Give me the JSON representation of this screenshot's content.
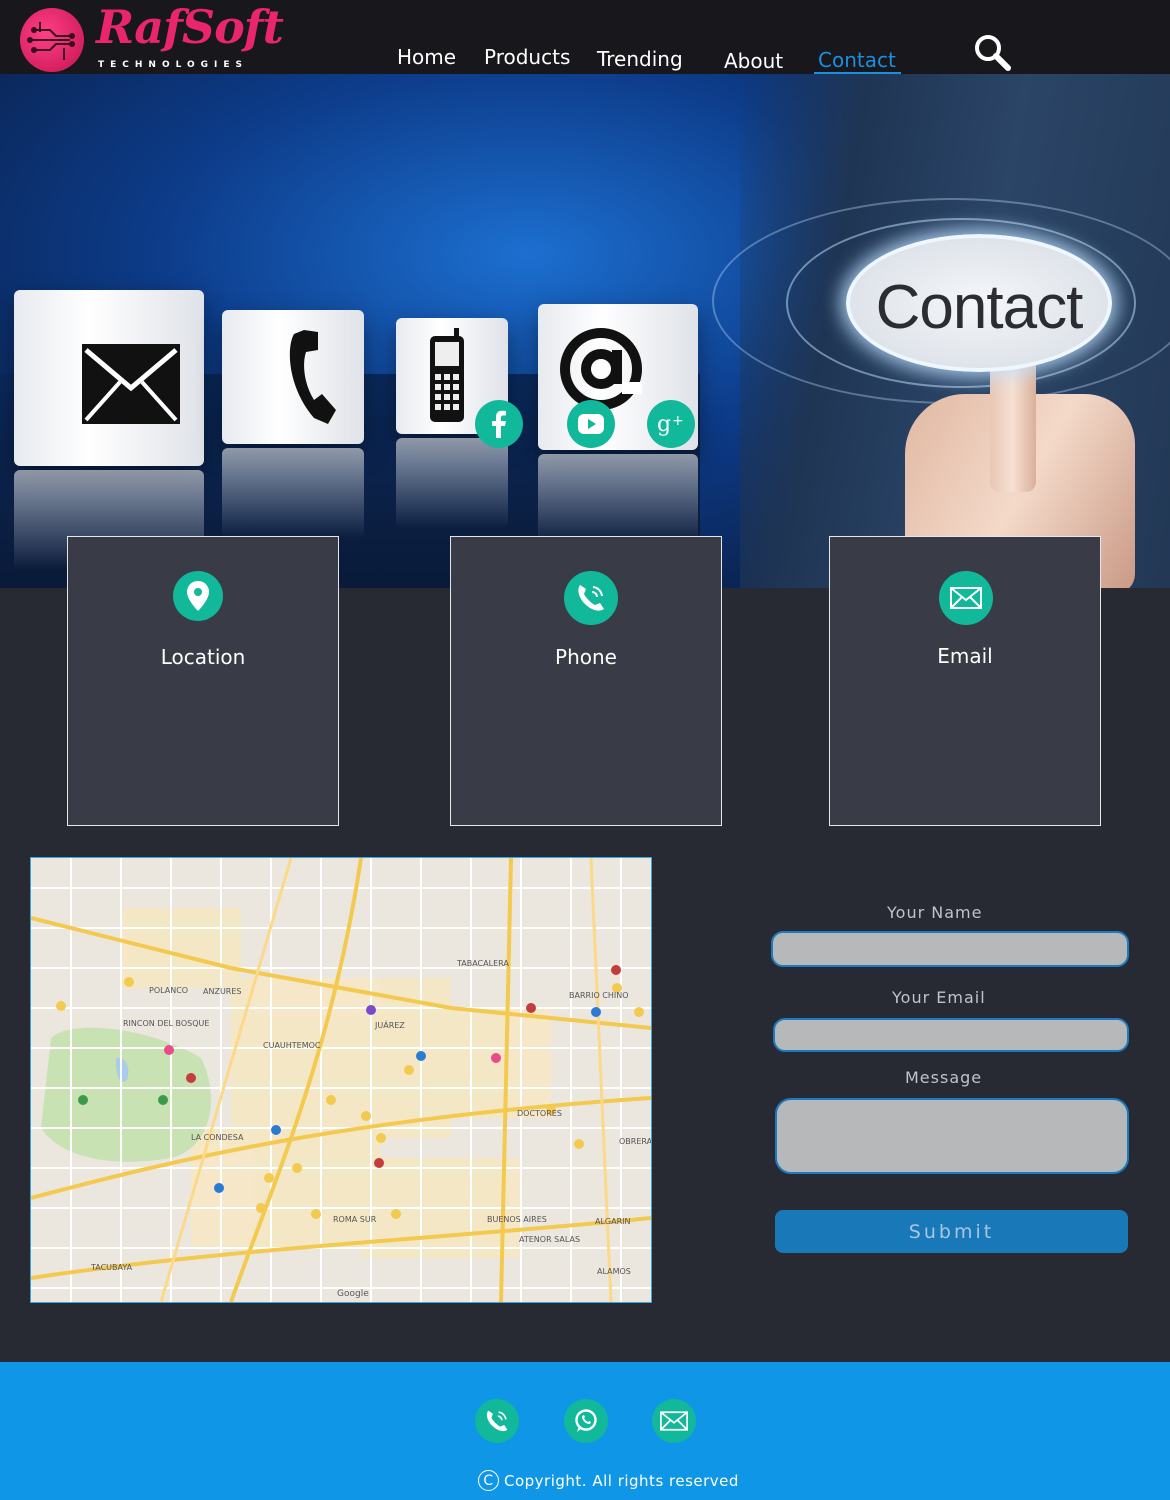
{
  "brand": {
    "name": "RafSoft",
    "tagline": "TECHNOLOGIES",
    "accent": "#e8256d"
  },
  "nav": {
    "items": [
      {
        "label": "Home"
      },
      {
        "label": "Products"
      },
      {
        "label": "Trending"
      },
      {
        "label": "About"
      },
      {
        "label": "Contact",
        "active": true
      }
    ],
    "active_color": "#1b8fe0"
  },
  "hero": {
    "sign_text": "Contact",
    "social_icons": [
      "facebook-icon",
      "youtube-icon",
      "google-plus-icon"
    ]
  },
  "cards": [
    {
      "title": "Location",
      "icon": "location-pin-icon"
    },
    {
      "title": "Phone",
      "icon": "phone-icon"
    },
    {
      "title": "Email",
      "icon": "email-icon"
    }
  ],
  "map": {
    "labels": [
      "POLANCO",
      "RINCON DEL BOSQUE",
      "ANZURES",
      "CUAUHTEMOC",
      "JUÁREZ",
      "TABACALERA",
      "BARRIO CHINO",
      "DOCTORES",
      "LA CONDESA",
      "ROMA SUR",
      "BUENOS AIRES",
      "ALGARIN",
      "TACUBAYA",
      "ATENOR SALAS",
      "OBRERA",
      "ALAMOS",
      "Google"
    ]
  },
  "form": {
    "name_label": "Your Name",
    "email_label": "Your Email",
    "message_label": "Message",
    "name_value": "",
    "email_value": "",
    "message_value": "",
    "submit_label": "Submit"
  },
  "footer": {
    "icons": [
      "phone-icon",
      "whatsapp-icon",
      "email-icon"
    ],
    "copyright_symbol": "C",
    "copyright": "Copyright. All rights reserved",
    "background": "#0f96e6"
  },
  "colors": {
    "teal": "#12b89a",
    "page_bg": "#272a33",
    "card_bg": "#393b46"
  }
}
